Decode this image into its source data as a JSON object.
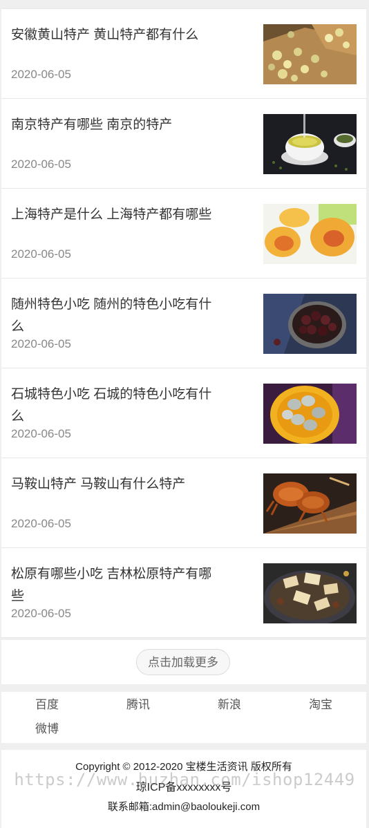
{
  "news": [
    {
      "title": "安徽黄山特产 黄山特产都有什么",
      "date": "2020-06-05",
      "thumb_icon": "chrysanthemum-tea-photo"
    },
    {
      "title": "南京特产有哪些 南京的特产",
      "date": "2020-06-05",
      "thumb_icon": "green-tea-cup-photo"
    },
    {
      "title": "上海特产是什么 上海特产都有哪些",
      "date": "2020-06-05",
      "thumb_icon": "yellow-peach-photo"
    },
    {
      "title": "随州特色小吃 随州的特色小吃有什么",
      "date": "2020-06-05",
      "thumb_icon": "dried-dates-bowl-photo"
    },
    {
      "title": "石城特色小吃 石城的特色小吃有什么",
      "date": "2020-06-05",
      "thumb_icon": "dumplings-bowl-photo"
    },
    {
      "title": "马鞍山特产 马鞍山有什么特产",
      "date": "2020-06-05",
      "thumb_icon": "hairy-crab-photo"
    },
    {
      "title": "松原有哪些小吃 吉林松原特产有哪些",
      "date": "2020-06-05",
      "thumb_icon": "stew-pan-photo"
    }
  ],
  "load_more": {
    "label": "点击加载更多"
  },
  "links": [
    {
      "label": "百度"
    },
    {
      "label": "腾讯"
    },
    {
      "label": "新浪"
    },
    {
      "label": "淘宝"
    },
    {
      "label": "微博"
    }
  ],
  "footer": {
    "copyright": "Copyright © 2012-2020 宝楼生活资讯 版权所有",
    "icp": "琼ICP备xxxxxxxx号",
    "email": "联系邮箱:admin@baoloukeji.com"
  },
  "watermark": "https://www.huzhan.com/ishop12449",
  "colors": {
    "background": "#efefef",
    "text": "#333333",
    "date": "#888888",
    "divider": "#e6e6e6"
  }
}
